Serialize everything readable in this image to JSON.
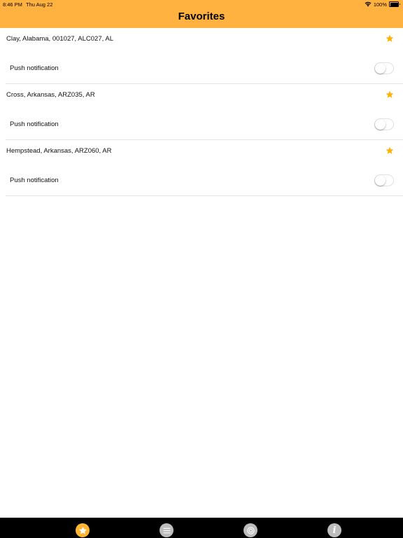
{
  "status": {
    "time": "8:46 PM",
    "date": "Thu Aug 22",
    "battery": "100%"
  },
  "header": {
    "title": "Favorites",
    "bg_color": "#ffb23f"
  },
  "favorites": [
    {
      "title": "Clay, Alabama, 001027, ALC027, AL",
      "push_label": "Push notification",
      "push_enabled": false
    },
    {
      "title": "Cross, Arkansas, ARZ035, AR",
      "push_label": "Push notification",
      "push_enabled": false
    },
    {
      "title": "Hempstead, Arkansas, ARZ060, AR",
      "push_label": "Push notification",
      "push_enabled": false
    }
  ],
  "tabbar": {
    "items": [
      {
        "icon": "star-icon",
        "active": true
      },
      {
        "icon": "list-icon",
        "active": false
      },
      {
        "icon": "target-icon",
        "active": false
      },
      {
        "icon": "info-icon",
        "active": false
      }
    ],
    "info_glyph": "i",
    "active_color": "#ffb531",
    "inactive_color": "#bdbdbd"
  }
}
